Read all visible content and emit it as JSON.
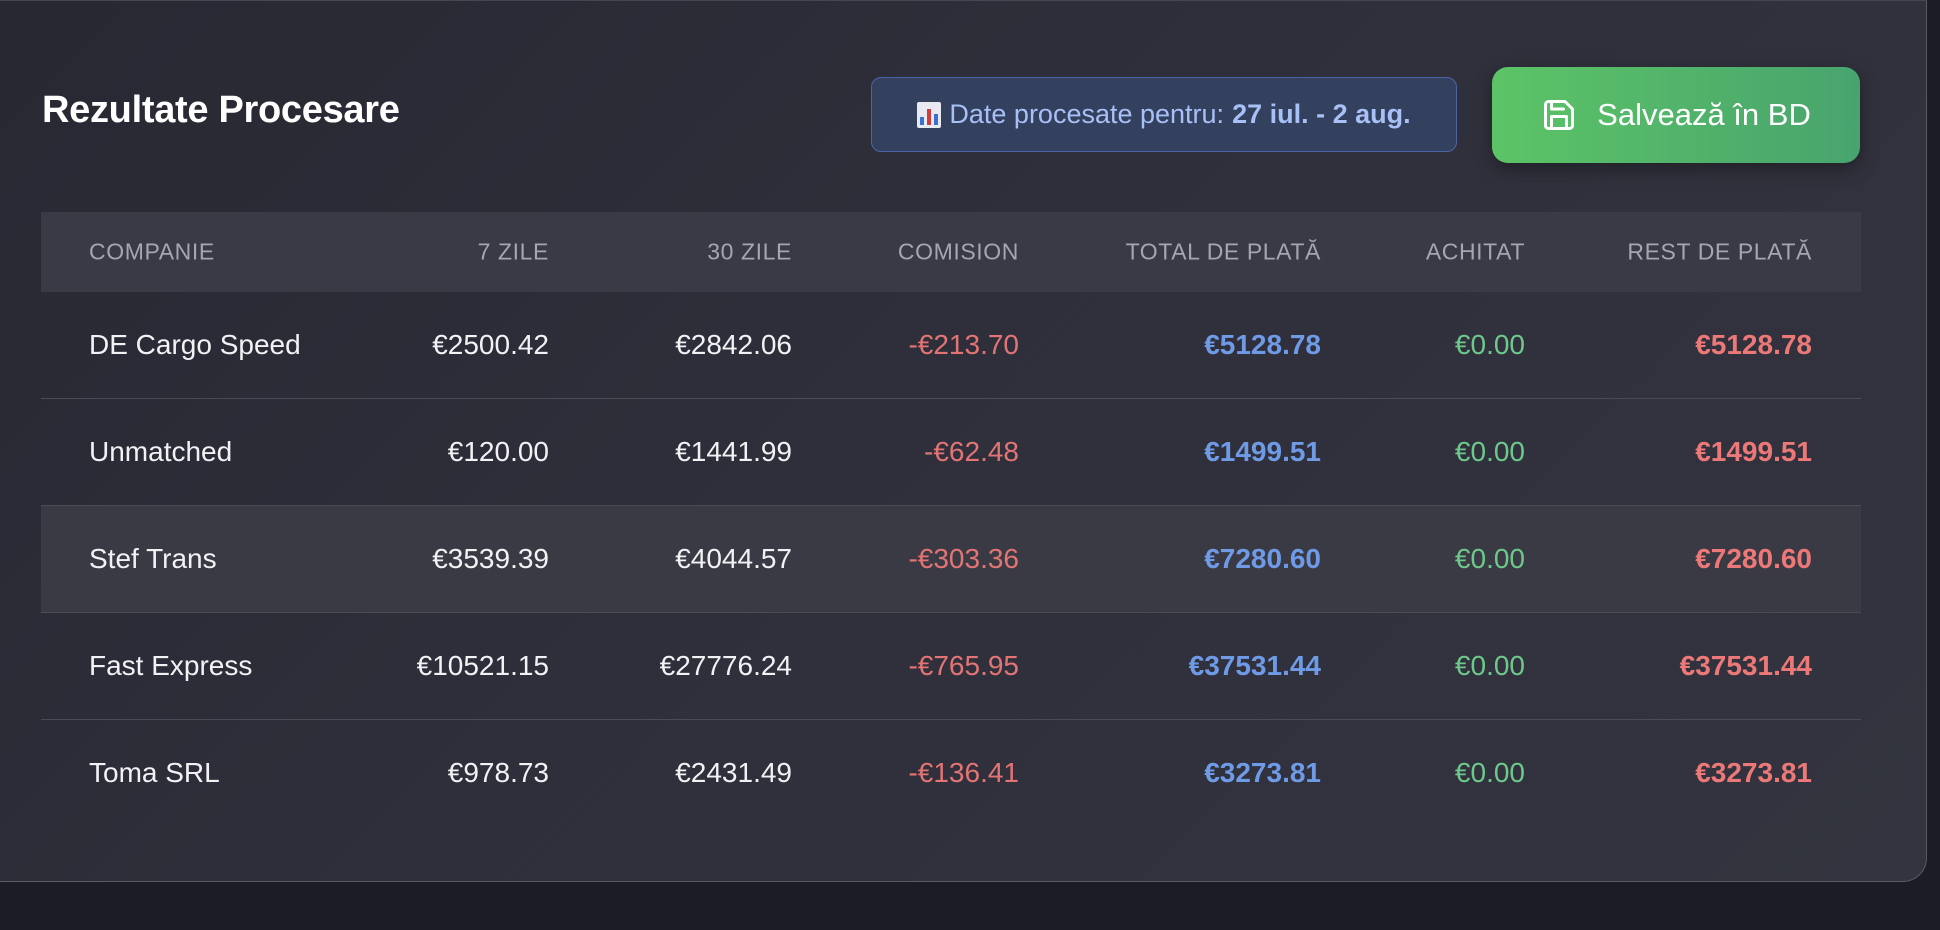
{
  "header": {
    "title": "Rezultate Procesare",
    "date_prefix": "Date procesate pentru:",
    "date_range": "27 iul. - 2 aug.",
    "save_label": "Salvează în BD"
  },
  "table": {
    "columns": [
      "COMPANIE",
      "7 ZILE",
      "30 ZILE",
      "COMISION",
      "TOTAL DE PLATĂ",
      "ACHITAT",
      "REST DE PLATĂ"
    ],
    "rows": [
      {
        "company": "DE Cargo Speed",
        "d7": "€2500.42",
        "d30": "€2842.06",
        "commission": "-€213.70",
        "total": "€5128.78",
        "paid": "€0.00",
        "rest": "€5128.78"
      },
      {
        "company": "Unmatched",
        "d7": "€120.00",
        "d30": "€1441.99",
        "commission": "-€62.48",
        "total": "€1499.51",
        "paid": "€0.00",
        "rest": "€1499.51"
      },
      {
        "company": "Stef Trans",
        "d7": "€3539.39",
        "d30": "€4044.57",
        "commission": "-€303.36",
        "total": "€7280.60",
        "paid": "€0.00",
        "rest": "€7280.60"
      },
      {
        "company": "Fast Express",
        "d7": "€10521.15",
        "d30": "€27776.24",
        "commission": "-€765.95",
        "total": "€37531.44",
        "paid": "€0.00",
        "rest": "€37531.44"
      },
      {
        "company": "Toma SRL",
        "d7": "€978.73",
        "d30": "€2431.49",
        "commission": "-€136.41",
        "total": "€3273.81",
        "paid": "€0.00",
        "rest": "€3273.81"
      }
    ]
  },
  "colors": {
    "accent_green": "#5cc466",
    "total_blue": "#6e9ae6",
    "paid_green": "#6cc98a",
    "rest_red": "#ec7878"
  },
  "icons": {
    "badge": "bar-chart-emoji-icon",
    "save": "floppy-disk-icon"
  }
}
